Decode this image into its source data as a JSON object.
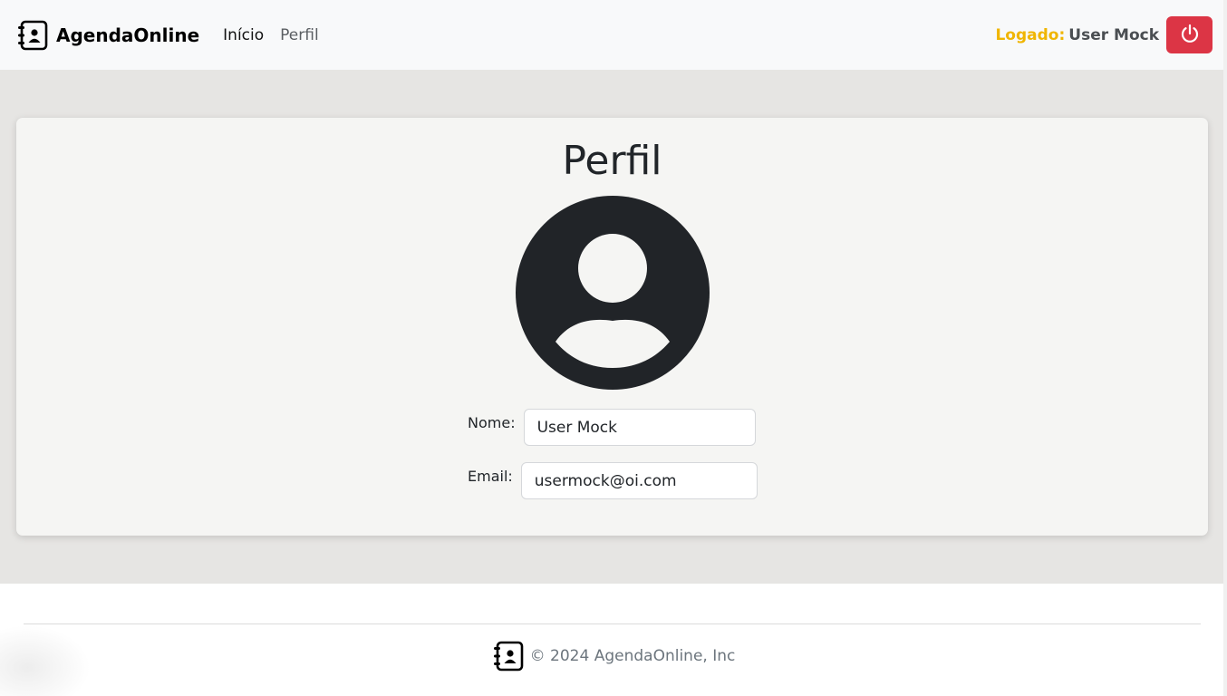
{
  "navbar": {
    "brand": "AgendaOnline",
    "brand_icon": "address-book-icon",
    "links": [
      {
        "label": "Início"
      },
      {
        "label": "Perfil"
      }
    ],
    "logged_label": "Logado:",
    "logged_user": "User Mock",
    "logout_icon": "power-icon"
  },
  "profile": {
    "title": "Perfil",
    "avatar_icon": "person-circle-icon",
    "name_label": "Nome:",
    "name_value": "User Mock",
    "email_label": "Email:",
    "email_value": "usermock@oi.com"
  },
  "footer": {
    "icon": "address-book-icon",
    "text": "© 2024 AgendaOnline, Inc"
  },
  "colors": {
    "navbar_bg": "#f8f9fa",
    "main_bg": "#e6e5e3",
    "card_bg": "#f5f5f3",
    "danger": "#dc3545",
    "warning": "#f0b500"
  }
}
